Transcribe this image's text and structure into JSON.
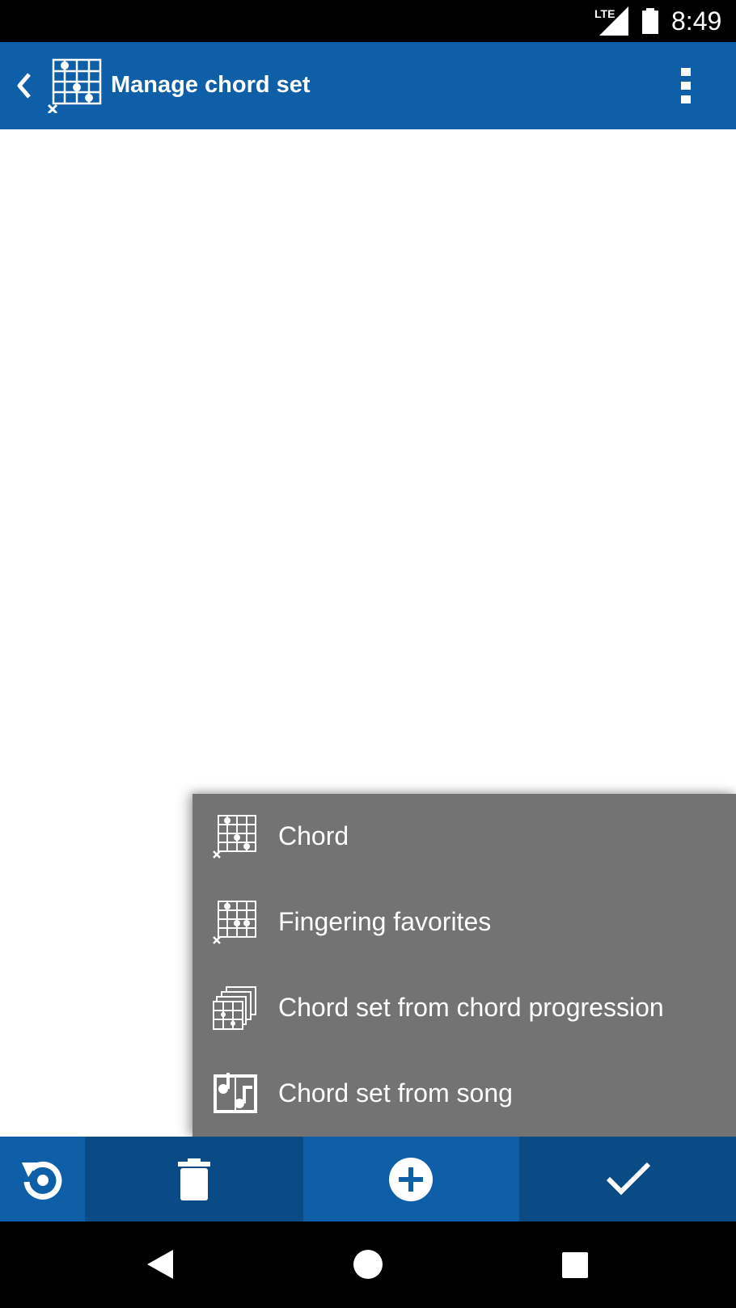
{
  "status_bar": {
    "network": "LTE",
    "time": "8:49",
    "icons": [
      "lte-signal-icon",
      "battery-icon"
    ]
  },
  "app_bar": {
    "title": "Manage chord set",
    "icons": [
      "back-icon",
      "chord-icon",
      "overflow-menu-icon"
    ]
  },
  "menu": {
    "items": [
      {
        "label": "Chord",
        "icon": "chord-icon"
      },
      {
        "label": "Fingering favorites",
        "icon": "fingering-favorites-icon"
      },
      {
        "label": "Chord set from chord progression",
        "icon": "chord-progression-icon"
      },
      {
        "label": "Chord set from song",
        "icon": "song-icon"
      }
    ]
  },
  "bottom_toolbar": {
    "buttons": [
      "reset-icon",
      "trash-icon",
      "add-icon",
      "check-icon"
    ]
  },
  "nav_bar": {
    "buttons": [
      "nav-back-icon",
      "nav-home-icon",
      "nav-recents-icon"
    ]
  },
  "colors": {
    "primary": "#0e5fa8",
    "toolbar_dark": "#0a4a85",
    "toolbar_active": "#0e5fa8",
    "menu_bg": "#737373",
    "text_on_dark": "#ffffff"
  }
}
